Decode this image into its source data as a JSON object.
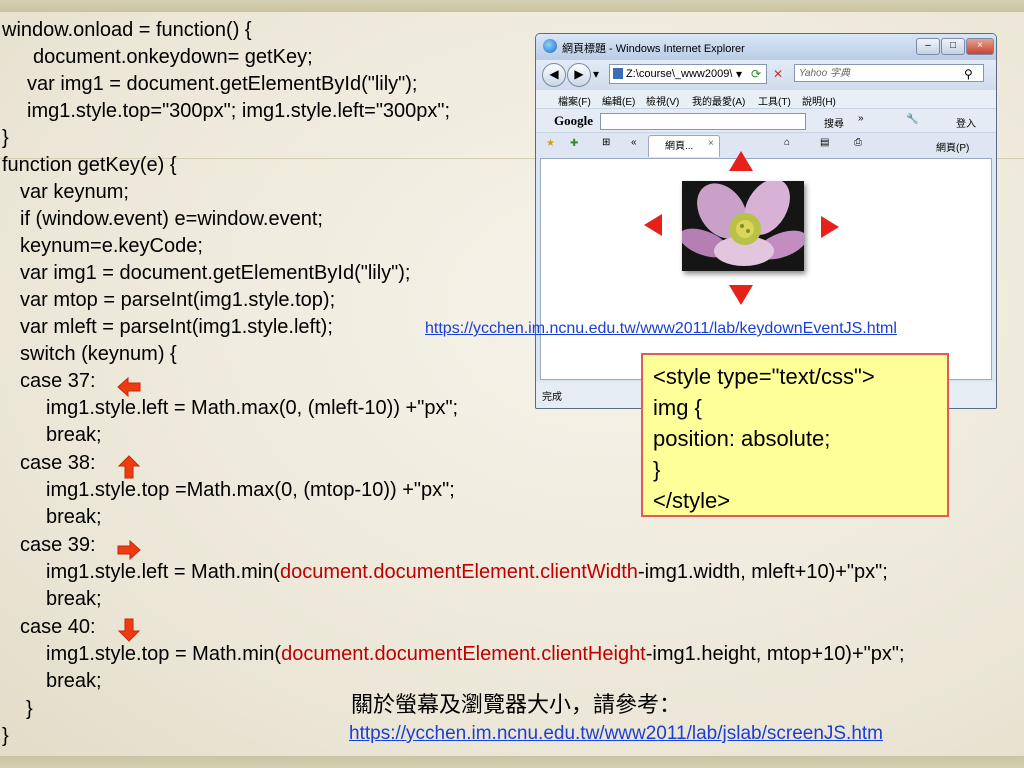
{
  "code": {
    "lines": [
      "window.onload =  function() {",
      "document.onkeydown= getKey;",
      "var img1 = document.getElementById(\"lily\");",
      "img1.style.top=\"300px\"; img1.style.left=\"300px\";",
      "}",
      "function getKey(e) {",
      "var keynum;",
      "if (window.event) e=window.event;",
      "keynum=e.keyCode;",
      "var img1 = document.getElementById(\"lily\");",
      "var mtop = parseInt(img1.style.top);",
      "var mleft = parseInt(img1.style.left);",
      "switch (keynum) {",
      "case 37:",
      "img1.style.left = Math.max(0, (mleft-10)) +\"px\";",
      "break;",
      "case 38:",
      "img1.style.top =Math.max(0, (mtop-10)) +\"px\";",
      "break;",
      "case 39:",
      "break;",
      "case 40:",
      "break;",
      "}",
      "}"
    ],
    "case39_pre": "img1.style.left = Math.min(",
    "case39_red": "document.documentElement.clientWidth",
    "case39_post": "-img1.width, mleft+10)+\"px\";",
    "case40_pre": "img1.style.top = Math.min(",
    "case40_red": "document.documentElement.clientHeight",
    "case40_post": "-img1.height, mtop+10)+\"px\";"
  },
  "browser": {
    "title": "網頁標題 - Windows Internet Explorer",
    "address": "Z:\\course\\_www2009\\",
    "search_placeholder": "Yahoo 字典",
    "menu": [
      "檔案(F)",
      "編輯(E)",
      "檢視(V)",
      "我的最愛(A)",
      "工具(T)",
      "說明(H)"
    ],
    "google_label": "Google",
    "search_btn": "搜尋",
    "login": "登入",
    "tab_label": "網頁...",
    "page_menu": "網頁(P)",
    "status": "完成"
  },
  "links": {
    "keydown": "https://ycchen.im.ncnu.edu.tw/www2011/lab/keydownEventJS.html",
    "screen": "https://ycchen.im.ncnu.edu.tw/www2011/lab/jslab/screenJS.htm"
  },
  "css_box": {
    "lines": [
      "<style type=\"text/css\">",
      "img {",
      "position: absolute;",
      "}",
      "</style>"
    ]
  },
  "note": "關於螢幕及瀏覽器大小，請參考：",
  "colors": {
    "arrow": "#e8201a",
    "code_red": "#c00000",
    "link": "#1a3fd6",
    "css_box_bg": "#ffff99"
  }
}
